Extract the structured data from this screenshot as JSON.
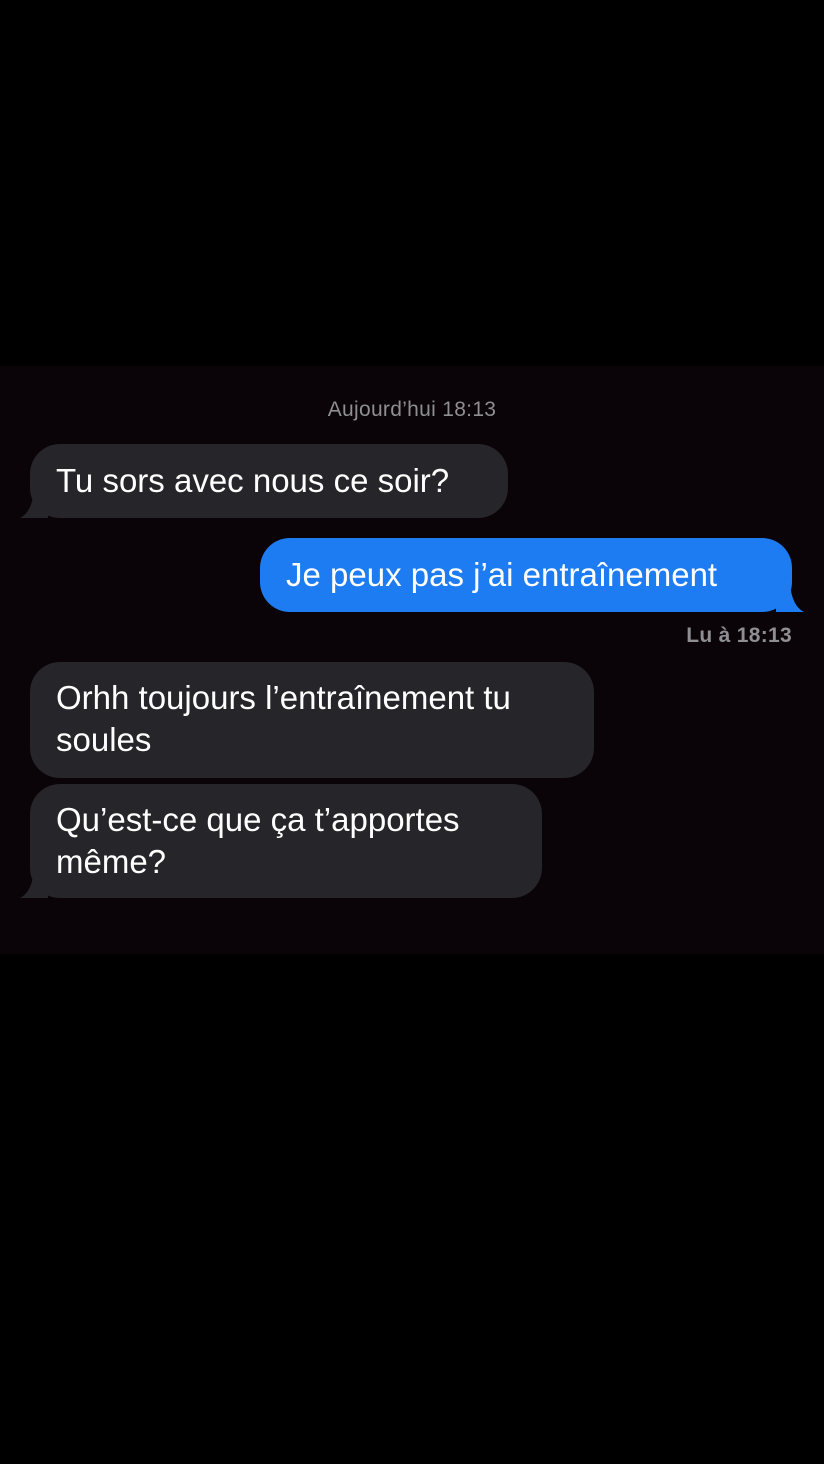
{
  "conversation": {
    "date_header": "Aujourd’hui 18:13",
    "messages": [
      {
        "direction": "received",
        "text": "Tu sors avec nous ce soir?"
      },
      {
        "direction": "sent",
        "text": "Je peux pas j’ai entraînement"
      },
      {
        "direction": "received",
        "text": "Orhh toujours l’entraînement tu\nsoules"
      },
      {
        "direction": "received",
        "text": "Qu’est-ce que ça t’apportes\nmême?"
      }
    ],
    "read_receipt": "Lu à 18:13"
  },
  "colors": {
    "background": "#000000",
    "chat_background": "#0a0307",
    "received_bubble": "#262529",
    "sent_bubble": "#1e7cf2",
    "meta_text": "#8e8e93"
  }
}
